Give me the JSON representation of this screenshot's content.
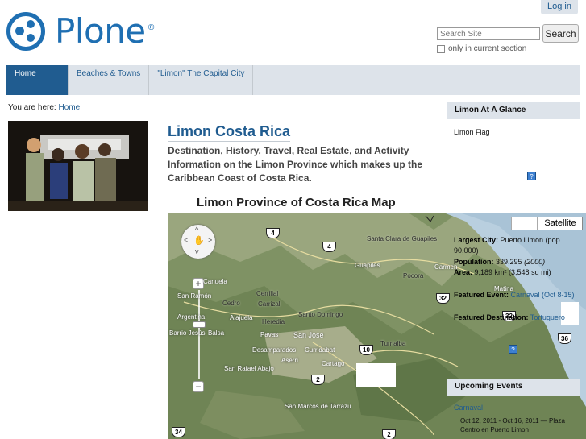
{
  "header": {
    "logo_text": "Plone",
    "logo_mark": "®",
    "login_label": "Log in",
    "search_placeholder": "Search Site",
    "search_button": "Search",
    "only_current_label": "only in current section"
  },
  "nav": {
    "tabs": [
      {
        "label": "Home",
        "active": true
      },
      {
        "label": "Beaches & Towns",
        "active": false
      },
      {
        "label": "\"Limon\" The Capital City",
        "active": false
      }
    ]
  },
  "breadcrumb": {
    "prefix": "You are here:",
    "home": "Home"
  },
  "main": {
    "title": "Limon Costa Rica",
    "description": "Destination, History, Travel, Real Estate, and Activity Information on the Limon Province which makes up the Caribbean Coast of Costa Rica.",
    "map_heading": "Limon Province of Costa Rica Map"
  },
  "map": {
    "satellite_label": "Satellite",
    "places": [
      "Santa Clara de Guapiles",
      "Guápiles",
      "Pocora",
      "Carmen",
      "Cerrillal",
      "Carrizal",
      "Cedro",
      "Alajuela",
      "Heredia",
      "Santo Domingo",
      "Pavas",
      "San Jose",
      "Desamparados",
      "Curridabat",
      "Turrialba",
      "Aserri",
      "Cartago",
      "San Rafael Abajo",
      "San Marcos de Tarrazu",
      "San Ramón",
      "Barrio Jesús",
      "Balsa",
      "Argentina",
      "Canuela",
      "San Rafael Abajo",
      "Matina"
    ],
    "routes": [
      "4",
      "4",
      "32",
      "32",
      "10",
      "2",
      "36",
      "34",
      "2"
    ]
  },
  "glance": {
    "heading": "Limon At A Glance",
    "flag_label": "Limon Flag",
    "largest_city_label": "Largest City:",
    "largest_city_value": "Puerto Limon (pop 90,000)",
    "population_label": "Population:",
    "population_value": "339,295",
    "population_year": "(2000)",
    "area_label": "Area:",
    "area_value": "9,189 km² (3,548 sq mi)",
    "featured_event_label": "Featured Event:",
    "featured_event_value": "Carnaval (Oct 8-15)",
    "featured_destination_label": "Featured Destination:",
    "featured_destination_value": "Tortuguero"
  },
  "events": {
    "heading": "Upcoming Events",
    "item_title": "Carnaval",
    "item_date": "Oct 12, 2011 - Oct 16, 2011 — Plaza Centro en Puerto Limon"
  },
  "colors": {
    "brand": "#1f6fb2",
    "link": "#205c90",
    "nav_bg": "#dde3ea",
    "nav_active": "#205c90"
  }
}
